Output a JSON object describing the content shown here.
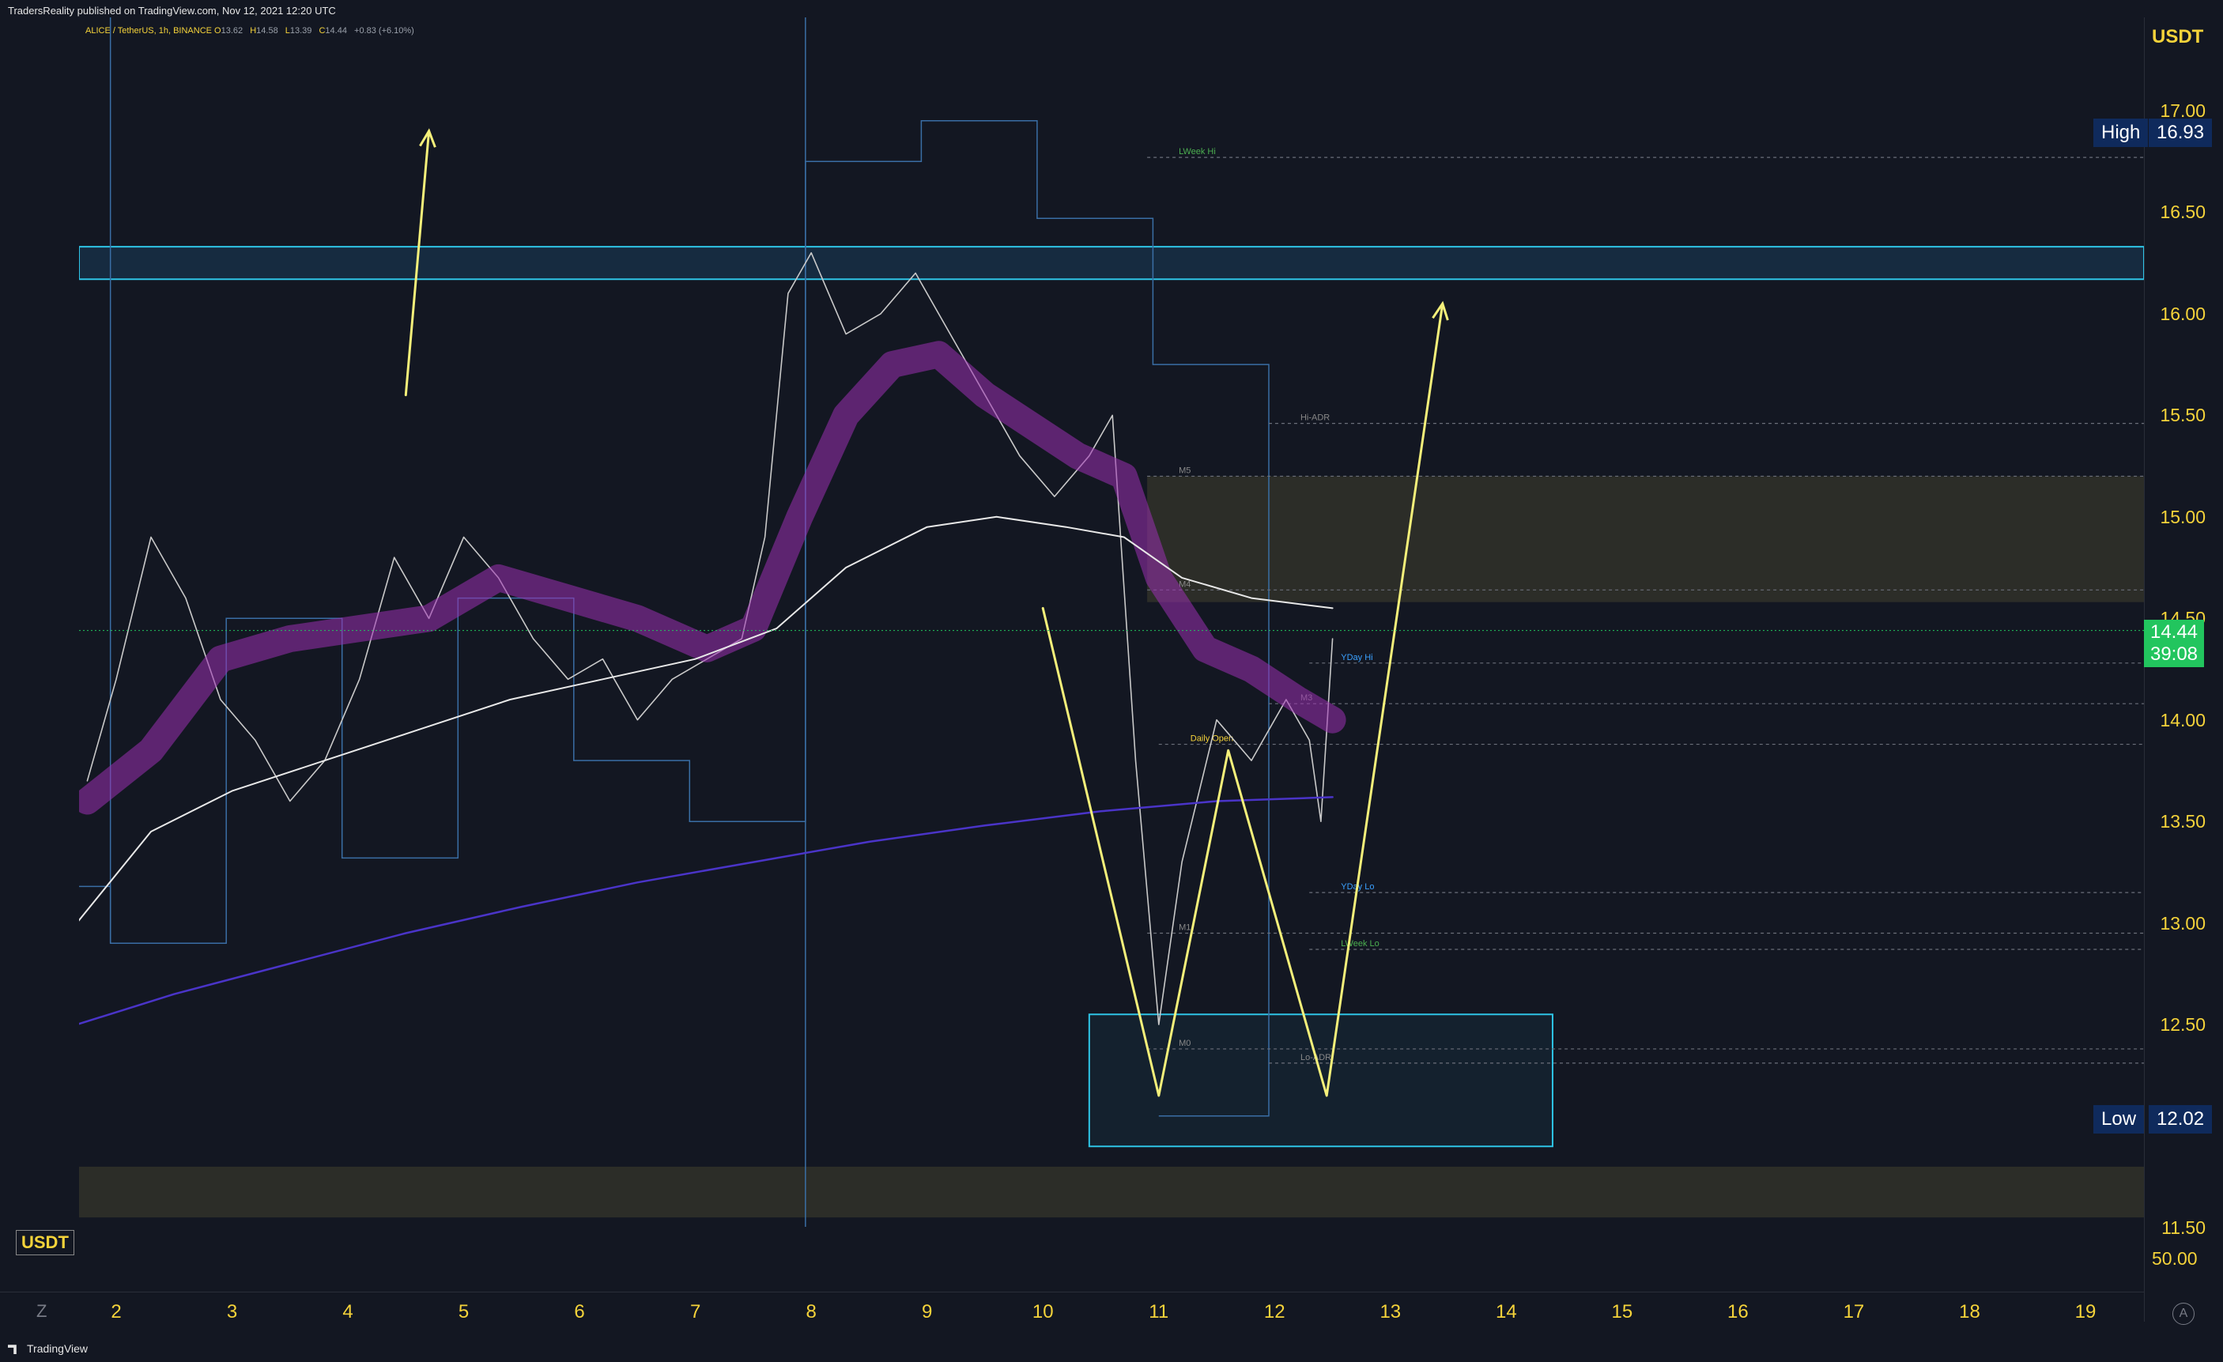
{
  "header": {
    "published": "TradersReality published on TradingView.com, Nov 12, 2021 12:20 UTC",
    "symbol": "ALICE / TetherUS, 1h, BINANCE",
    "o_label": "O",
    "o_value": "13.62",
    "h_label": "H",
    "h_value": "14.58",
    "l_label": "L",
    "l_value": "13.39",
    "c_label": "C",
    "c_value": "14.44",
    "change": "+0.83 (+6.10%)"
  },
  "axis": {
    "currency": "USDT",
    "osc_currency": "USDT",
    "osc_level": "50.00",
    "high_label": "High",
    "high_value": "16.93",
    "low_label": "Low",
    "low_value": "12.02",
    "current_price": "14.44",
    "countdown": "39:08",
    "z_button": "Z",
    "a_button": "A",
    "brand": "TradingView"
  },
  "colors": {
    "background": "#131722",
    "up": "#26a69a",
    "down": "#ef5350",
    "accent": "#f5d33a",
    "cyan": "#2ec4e6",
    "ribbon": "#9b30b0",
    "current_price": "#22c55e",
    "badge": "#0f2a5c"
  },
  "level_tags": {
    "lweek_hi": "LWeek Hi",
    "hi_adr": "Hi-ADR",
    "m5": "M5",
    "m4": "M4",
    "yday_hi": "YDay Hi",
    "m3": "M3",
    "daily_open": "Daily Open",
    "yday_lo": "YDay Lo",
    "m1": "M1",
    "lweek_lo": "LWeek Lo",
    "m0": "M0",
    "lo_adr": "Lo-ADR"
  },
  "chart_data": {
    "type": "line",
    "title": "ALICE / TetherUS, 1h, BINANCE",
    "y_ticks": [
      "17.00",
      "16.50",
      "16.00",
      "15.50",
      "15.00",
      "14.50",
      "14.00",
      "13.50",
      "13.00",
      "12.50",
      "11.50"
    ],
    "ylim": [
      11.5,
      17.0
    ],
    "x_ticks": [
      "2",
      "3",
      "4",
      "5",
      "6",
      "7",
      "8",
      "9",
      "10",
      "11",
      "12",
      "13",
      "14",
      "15",
      "16",
      "17",
      "18",
      "19"
    ],
    "xlim": [
      1.66,
      19.7
    ],
    "grid": false,
    "series": [
      {
        "values": [
          [
            1.75,
            13.7
          ],
          [
            2.0,
            14.2
          ],
          [
            2.3,
            14.9
          ],
          [
            2.6,
            14.6
          ],
          [
            2.9,
            14.1
          ],
          [
            3.2,
            13.9
          ],
          [
            3.5,
            13.6
          ],
          [
            3.8,
            13.8
          ],
          [
            4.1,
            14.2
          ],
          [
            4.4,
            14.8
          ],
          [
            4.7,
            14.5
          ],
          [
            5.0,
            14.9
          ],
          [
            5.3,
            14.7
          ],
          [
            5.6,
            14.4
          ],
          [
            5.9,
            14.2
          ],
          [
            6.2,
            14.3
          ],
          [
            6.5,
            14.0
          ],
          [
            6.8,
            14.2
          ],
          [
            7.1,
            14.3
          ],
          [
            7.4,
            14.4
          ],
          [
            7.6,
            14.9
          ],
          [
            7.8,
            16.1
          ],
          [
            8.0,
            16.3
          ],
          [
            8.3,
            15.9
          ],
          [
            8.6,
            16.0
          ],
          [
            8.9,
            16.2
          ],
          [
            9.2,
            15.9
          ],
          [
            9.5,
            15.6
          ],
          [
            9.8,
            15.3
          ],
          [
            10.1,
            15.1
          ],
          [
            10.4,
            15.3
          ],
          [
            10.6,
            15.5
          ],
          [
            10.8,
            13.8
          ],
          [
            11.0,
            12.5
          ],
          [
            11.2,
            13.3
          ],
          [
            11.5,
            14.0
          ],
          [
            11.8,
            13.8
          ],
          [
            12.1,
            14.1
          ],
          [
            12.3,
            13.9
          ],
          [
            12.4,
            13.5
          ],
          [
            12.5,
            14.4
          ]
        ]
      },
      {
        "values": [
          [
            1.75,
            13.6
          ],
          [
            2.3,
            13.85
          ],
          [
            2.9,
            14.3
          ],
          [
            3.5,
            14.4
          ],
          [
            4.1,
            14.45
          ],
          [
            4.7,
            14.5
          ],
          [
            5.3,
            14.7
          ],
          [
            5.9,
            14.6
          ],
          [
            6.5,
            14.5
          ],
          [
            7.1,
            14.35
          ],
          [
            7.5,
            14.45
          ],
          [
            7.9,
            15.0
          ],
          [
            8.3,
            15.5
          ],
          [
            8.7,
            15.75
          ],
          [
            9.1,
            15.8
          ],
          [
            9.5,
            15.6
          ],
          [
            9.9,
            15.45
          ],
          [
            10.3,
            15.3
          ],
          [
            10.7,
            15.2
          ],
          [
            11.0,
            14.7
          ],
          [
            11.4,
            14.35
          ],
          [
            11.8,
            14.25
          ],
          [
            12.2,
            14.1
          ],
          [
            12.5,
            14.0
          ]
        ]
      },
      {
        "values": [
          [
            1.66,
            13.0
          ],
          [
            2.3,
            13.45
          ],
          [
            3.0,
            13.65
          ],
          [
            3.8,
            13.8
          ],
          [
            4.6,
            13.95
          ],
          [
            5.4,
            14.1
          ],
          [
            6.2,
            14.2
          ],
          [
            7.0,
            14.3
          ],
          [
            7.7,
            14.45
          ],
          [
            8.3,
            14.75
          ],
          [
            9.0,
            14.95
          ],
          [
            9.6,
            15.0
          ],
          [
            10.2,
            14.95
          ],
          [
            10.7,
            14.9
          ],
          [
            11.2,
            14.7
          ],
          [
            11.8,
            14.6
          ],
          [
            12.5,
            14.55
          ]
        ]
      },
      {
        "values": [
          [
            1.66,
            12.5
          ],
          [
            2.5,
            12.65
          ],
          [
            3.5,
            12.8
          ],
          [
            4.5,
            12.95
          ],
          [
            5.5,
            13.08
          ],
          [
            6.5,
            13.2
          ],
          [
            7.5,
            13.3
          ],
          [
            8.5,
            13.4
          ],
          [
            9.5,
            13.48
          ],
          [
            10.5,
            13.55
          ],
          [
            11.5,
            13.6
          ],
          [
            12.5,
            13.62
          ]
        ]
      },
      {
        "values": [
          [
            10.0,
            14.55
          ],
          [
            11.0,
            12.15
          ],
          [
            11.6,
            13.85
          ],
          [
            12.45,
            12.15
          ],
          [
            13.45,
            16.05
          ]
        ]
      },
      {
        "values": [
          [
            4.5,
            15.6
          ],
          [
            4.7,
            16.9
          ]
        ]
      }
    ],
    "zones": [
      {
        "from": 16.17,
        "to": 16.33
      },
      {
        "from": 14.58,
        "to": 15.2
      },
      {
        "from": 11.55,
        "to": 11.8
      },
      {
        "from": 11.9,
        "to": 12.55
      }
    ]
  }
}
